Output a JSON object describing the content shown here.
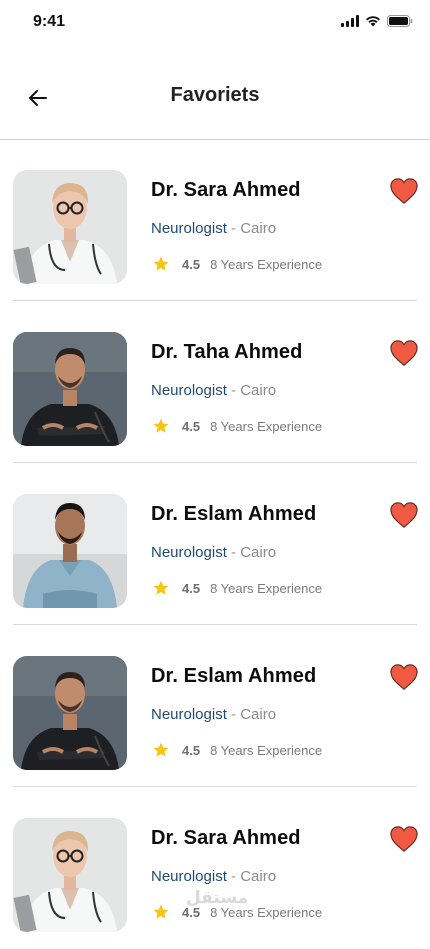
{
  "status_bar": {
    "time": "9:41"
  },
  "header": {
    "title": "Favoriets"
  },
  "colors": {
    "heart": "#f05a42",
    "star": "#f5c518",
    "specialty": "#1f4a73"
  },
  "doctors": [
    {
      "name": "Dr. Sara Ahmed",
      "specialty": "Neurologist",
      "separator": " - ",
      "city": "Cairo",
      "rating": "4.5",
      "experience": "8 Years Experience"
    },
    {
      "name": "Dr. Taha Ahmed",
      "specialty": "Neurologist",
      "separator": " - ",
      "city": "Cairo",
      "rating": "4.5",
      "experience": "8 Years Experience"
    },
    {
      "name": "Dr. Eslam Ahmed",
      "specialty": "Neurologist",
      "separator": " - ",
      "city": "Cairo",
      "rating": "4.5",
      "experience": "8 Years Experience"
    },
    {
      "name": "Dr. Eslam Ahmed",
      "specialty": "Neurologist",
      "separator": " - ",
      "city": "Cairo",
      "rating": "4.5",
      "experience": "8 Years Experience"
    },
    {
      "name": "Dr. Sara Ahmed",
      "specialty": "Neurologist",
      "separator": " - ",
      "city": "Cairo",
      "rating": "4.5",
      "experience": "8 Years Experience"
    }
  ],
  "watermark": "مستقل"
}
